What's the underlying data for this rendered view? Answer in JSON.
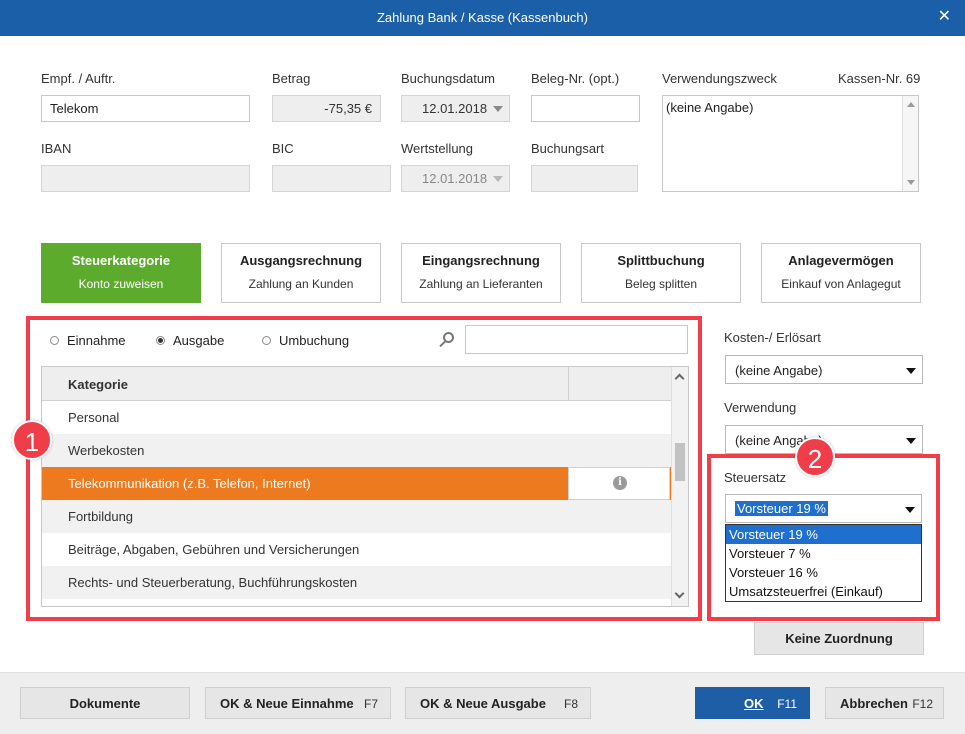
{
  "window": {
    "title": "Zahlung Bank / Kasse (Kassenbuch)",
    "close_glyph": "✕"
  },
  "form": {
    "empf_label": "Empf. / Auftr.",
    "empf_value": "Telekom",
    "betrag_label": "Betrag",
    "betrag_value": "-75,35 €",
    "buchungsdatum_label": "Buchungsdatum",
    "buchungsdatum_value": "12.01.2018",
    "beleg_label": "Beleg-Nr. (opt.)",
    "beleg_value": "",
    "verwendungszweck_label": "Verwendungszweck",
    "kassen_nr": "Kassen-Nr. 69",
    "verwendungszweck_value": "(keine Angabe)",
    "iban_label": "IBAN",
    "iban_value": "",
    "bic_label": "BIC",
    "bic_value": "",
    "wertstellung_label": "Wertstellung",
    "wertstellung_value": "12.01.2018",
    "buchungsart_label": "Buchungsart",
    "buchungsart_value": ""
  },
  "tiles": [
    {
      "title": "Steuerkategorie",
      "subtitle": "Konto zuweisen"
    },
    {
      "title": "Ausgangsrechnung",
      "subtitle": "Zahlung an Kunden"
    },
    {
      "title": "Eingangsrechnung",
      "subtitle": "Zahlung an Lieferanten"
    },
    {
      "title": "Splittbuchung",
      "subtitle": "Beleg splitten"
    },
    {
      "title": "Anlagevermögen",
      "subtitle": "Einkauf von Anlagegut"
    }
  ],
  "radios": {
    "einnahme": "Einnahme",
    "ausgabe": "Ausgabe",
    "umbuchung": "Umbuchung",
    "selected": "ausgabe"
  },
  "search": {
    "value": ""
  },
  "table": {
    "header": "Kategorie",
    "rows": [
      "Personal",
      "Werbekosten",
      "Telekommunikation (z.B. Telefon, Internet)",
      "Fortbildung",
      "Beiträge, Abgaben, Gebühren und Versicherungen",
      "Rechts- und Steuerberatung, Buchführungskosten"
    ],
    "selected_row": 2
  },
  "right_panel": {
    "kosten_label": "Kosten-/ Erlösart",
    "kosten_value": "(keine Angabe)",
    "verwendung_label": "Verwendung",
    "verwendung_value": "(keine Angabe)",
    "steuersatz_label": "Steuersatz",
    "steuersatz_value": "Vorsteuer 19 %",
    "steuersatz_options": [
      "Vorsteuer 19 %",
      "Vorsteuer 7 %",
      "Vorsteuer 16 %",
      "Umsatzsteuerfrei (Einkauf)"
    ],
    "keine_zuordnung": "Keine Zuordnung"
  },
  "badges": {
    "one": "1",
    "two": "2"
  },
  "footer": {
    "dokumente": "Dokumente",
    "ok_neue_einnahme": "OK & Neue Einnahme",
    "ok_neue_einnahme_key": "F7",
    "ok_neue_ausgabe": "OK & Neue Ausgabe",
    "ok_neue_ausgabe_key": "F8",
    "ok": "OK",
    "ok_key": "F11",
    "abbrechen": "Abbrechen",
    "abbrechen_key": "F12"
  },
  "colors": {
    "titlebar": "#1b5fa8",
    "active_tile": "#5dab2c",
    "selected_row": "#ee7a1f",
    "highlight_box": "#ef3e4a",
    "dropdown_highlight": "#1f6fcf"
  }
}
